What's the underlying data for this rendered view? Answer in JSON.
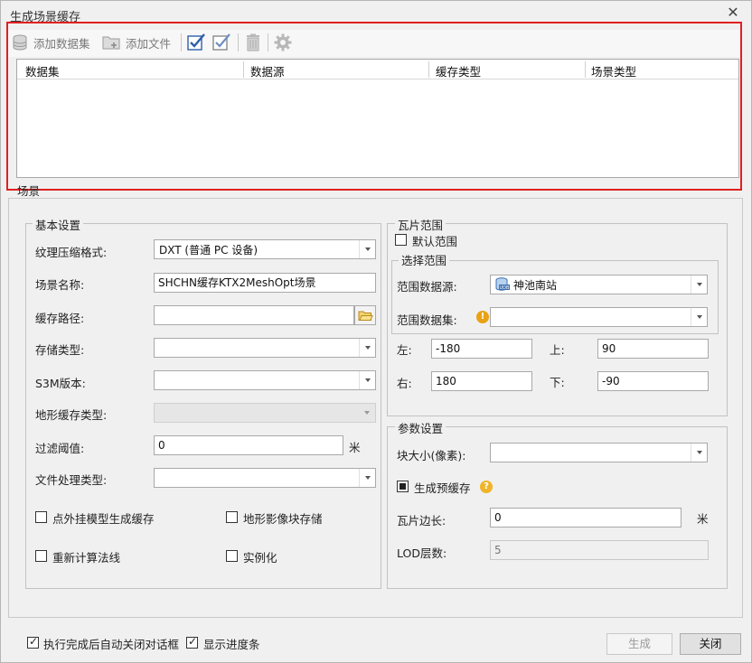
{
  "window": {
    "title": "生成场景缓存",
    "close_glyph": "✕"
  },
  "toolbar": {
    "add_dataset": "添加数据集",
    "add_file": "添加文件"
  },
  "grid": {
    "columns": [
      "数据集",
      "数据源",
      "缓存类型",
      "场景类型"
    ]
  },
  "tabs": {
    "scene": "场景"
  },
  "basic": {
    "title": "基本设置",
    "texture_label": "纹理压缩格式:",
    "texture_value": "DXT (普通 PC 设备)",
    "scene_name_label": "场景名称:",
    "scene_name_value": "SHCHN缓存KTX2MeshOpt场景",
    "cache_path_label": "缓存路径:",
    "cache_path_value": "",
    "storage_type_label": "存储类型:",
    "storage_type_value": "",
    "s3m_label": "S3M版本:",
    "s3m_value": "",
    "terrain_type_label": "地形缓存类型:",
    "terrain_type_value": "",
    "filter_label": "过滤阈值:",
    "filter_value": "0",
    "filter_unit": "米",
    "file_proc_label": "文件处理类型:",
    "file_proc_value": "",
    "opt_external": "点外挂模型生成缓存",
    "opt_terrain_block": "地形影像块存储",
    "opt_recalc_normals": "重新计算法线",
    "opt_instancing": "实例化"
  },
  "tile_range": {
    "title": "瓦片范围",
    "default_range": "默认范围",
    "select_title": "选择范围",
    "ds_label": "范围数据源:",
    "ds_value": "神池南站",
    "dataset_label": "范围数据集:",
    "dataset_value": "",
    "left_label": "左:",
    "left_value": "-180",
    "top_label": "上:",
    "top_value": "90",
    "right_label": "右:",
    "right_value": "180",
    "bottom_label": "下:",
    "bottom_value": "-90"
  },
  "params": {
    "title": "参数设置",
    "block_size_label": "块大小(像素):",
    "block_size_value": "",
    "gen_pre_cache": "生成预缓存",
    "tile_side_label": "瓦片边长:",
    "tile_side_value": "0",
    "tile_side_unit": "米",
    "lod_label": "LOD层数:",
    "lod_value": "5"
  },
  "footer": {
    "auto_close": "执行完成后自动关闭对话框",
    "show_progress": "显示进度条",
    "generate": "生成",
    "close": "关闭"
  }
}
